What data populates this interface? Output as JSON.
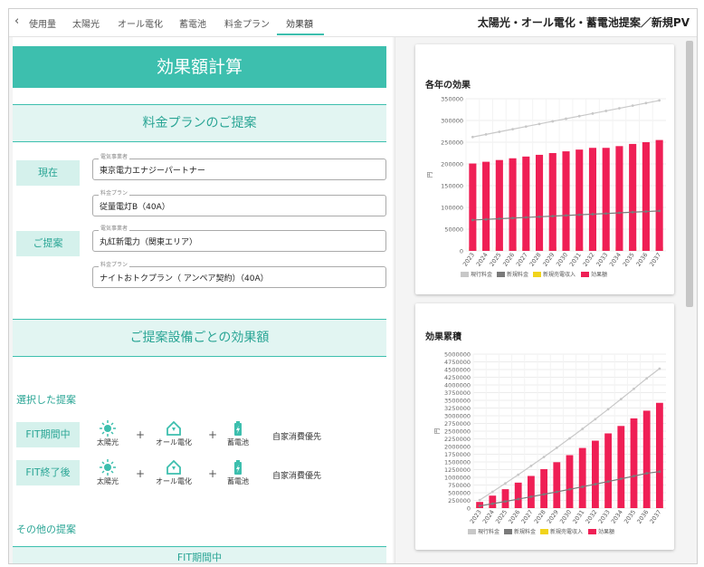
{
  "nav": {
    "back_icon": "chevron-left-icon",
    "tabs": [
      {
        "label": "使用量"
      },
      {
        "label": "太陽光"
      },
      {
        "label": "オール電化"
      },
      {
        "label": "蓄電池"
      },
      {
        "label": "料金プラン"
      },
      {
        "label": "効果額"
      }
    ],
    "active_tab": "効果額",
    "title": "太陽光・オール電化・蓄電池提案／新規PV"
  },
  "main": {
    "banner": "効果額計算",
    "plan_section": {
      "heading": "料金プランのご提案",
      "current_label": "現在",
      "proposal_label": "ご提案",
      "current_provider": {
        "legend": "電気事業者",
        "value": "東京電力エナジーパートナー"
      },
      "current_plan": {
        "legend": "料金プラン",
        "value": "従量電灯B（40A）"
      },
      "proposal_provider": {
        "legend": "電気事業者",
        "value": "丸紅新電力（関東エリア）"
      },
      "proposal_plan": {
        "legend": "料金プラン",
        "value": "ナイトおトクプラン（ アンペア契約）（40A）"
      }
    },
    "equipment_section": {
      "heading": "ご提案設備ごとの効果額",
      "selected_heading": "選択した提案",
      "rows": [
        {
          "label": "FIT期間中",
          "items": [
            "太陽光",
            "オール電化",
            "蓄電池"
          ],
          "note": "自家消費優先"
        },
        {
          "label": "FIT終了後",
          "items": [
            "太陽光",
            "オール電化",
            "蓄電池"
          ],
          "note": "自家消費優先"
        }
      ],
      "plus": "+",
      "other_heading": "その他の提案",
      "other_banner": "FIT期間中"
    }
  },
  "colors": {
    "accent": "#3dbfae",
    "current_fee": "#c8c8c8",
    "new_fee": "#7a7a7a",
    "new_sales": "#f1d41c",
    "effect": "#ef1f55"
  },
  "chart_data": [
    {
      "type": "bar",
      "title": "各年の効果",
      "ylabel": "円",
      "ylim": [
        0,
        350000
      ],
      "yticks": [
        0,
        50000,
        100000,
        150000,
        200000,
        250000,
        300000,
        350000
      ],
      "categories": [
        "2023",
        "2024",
        "2025",
        "2026",
        "2027",
        "2028",
        "2029",
        "2030",
        "2031",
        "2032",
        "2033",
        "2034",
        "2035",
        "2036",
        "2037"
      ],
      "legend_position": "bottom",
      "series": [
        {
          "name": "現行料金",
          "kind": "line",
          "values": [
            262000,
            268000,
            274000,
            280000,
            286000,
            292000,
            298000,
            304000,
            310000,
            316000,
            322000,
            328000,
            334000,
            340000,
            346000
          ]
        },
        {
          "name": "新規料金",
          "kind": "line",
          "values": [
            71000,
            72500,
            74000,
            75500,
            77000,
            78500,
            80000,
            81500,
            83000,
            84500,
            86000,
            87500,
            89000,
            90500,
            92000
          ]
        },
        {
          "name": "新規売電収入",
          "kind": "bar",
          "values": [
            9000,
            9000,
            9000,
            9000,
            9000,
            9000,
            9000,
            9000,
            9000,
            9000,
            9000,
            9000,
            9000,
            9000,
            9000
          ]
        },
        {
          "name": "効果額",
          "kind": "bar",
          "values": [
            201000,
            205000,
            209000,
            213000,
            217000,
            221000,
            225000,
            229000,
            233000,
            237000,
            237000,
            241000,
            246000,
            250000,
            255000
          ]
        }
      ]
    },
    {
      "type": "bar",
      "title": "効果累積",
      "ylabel": "円",
      "ylim": [
        0,
        5000000
      ],
      "yticks": [
        0,
        250000,
        500000,
        750000,
        1000000,
        1250000,
        1500000,
        1750000,
        2000000,
        2250000,
        2500000,
        2750000,
        3000000,
        3250000,
        3500000,
        3750000,
        4000000,
        4250000,
        4500000,
        4750000,
        5000000
      ],
      "categories": [
        "2023",
        "2024",
        "2025",
        "2026",
        "2027",
        "2028",
        "2029",
        "2030",
        "2031",
        "2032",
        "2033",
        "2034",
        "2035",
        "2036",
        "2037"
      ],
      "legend_position": "bottom",
      "series": [
        {
          "name": "現行料金",
          "kind": "line",
          "values": [
            262000,
            530000,
            804000,
            1084000,
            1370000,
            1662000,
            1960000,
            2264000,
            2574000,
            2890000,
            3212000,
            3540000,
            3874000,
            4214000,
            4530000
          ]
        },
        {
          "name": "新規料金",
          "kind": "line",
          "values": [
            71000,
            143500,
            217500,
            293000,
            370000,
            448500,
            528500,
            610000,
            693000,
            777500,
            863500,
            951000,
            1040000,
            1130500,
            1185000
          ]
        },
        {
          "name": "新規売電収入",
          "kind": "bar",
          "values": [
            90000,
            90000,
            90000,
            90000,
            90000,
            90000,
            90000,
            90000,
            90000,
            90000,
            90000,
            90000,
            90000,
            90000,
            90000
          ]
        },
        {
          "name": "効果額",
          "kind": "bar",
          "values": [
            201000,
            406000,
            615000,
            828000,
            1045000,
            1266000,
            1491000,
            1720000,
            1953000,
            2190000,
            2427000,
            2668000,
            2914000,
            3164000,
            3419000
          ]
        }
      ]
    }
  ]
}
